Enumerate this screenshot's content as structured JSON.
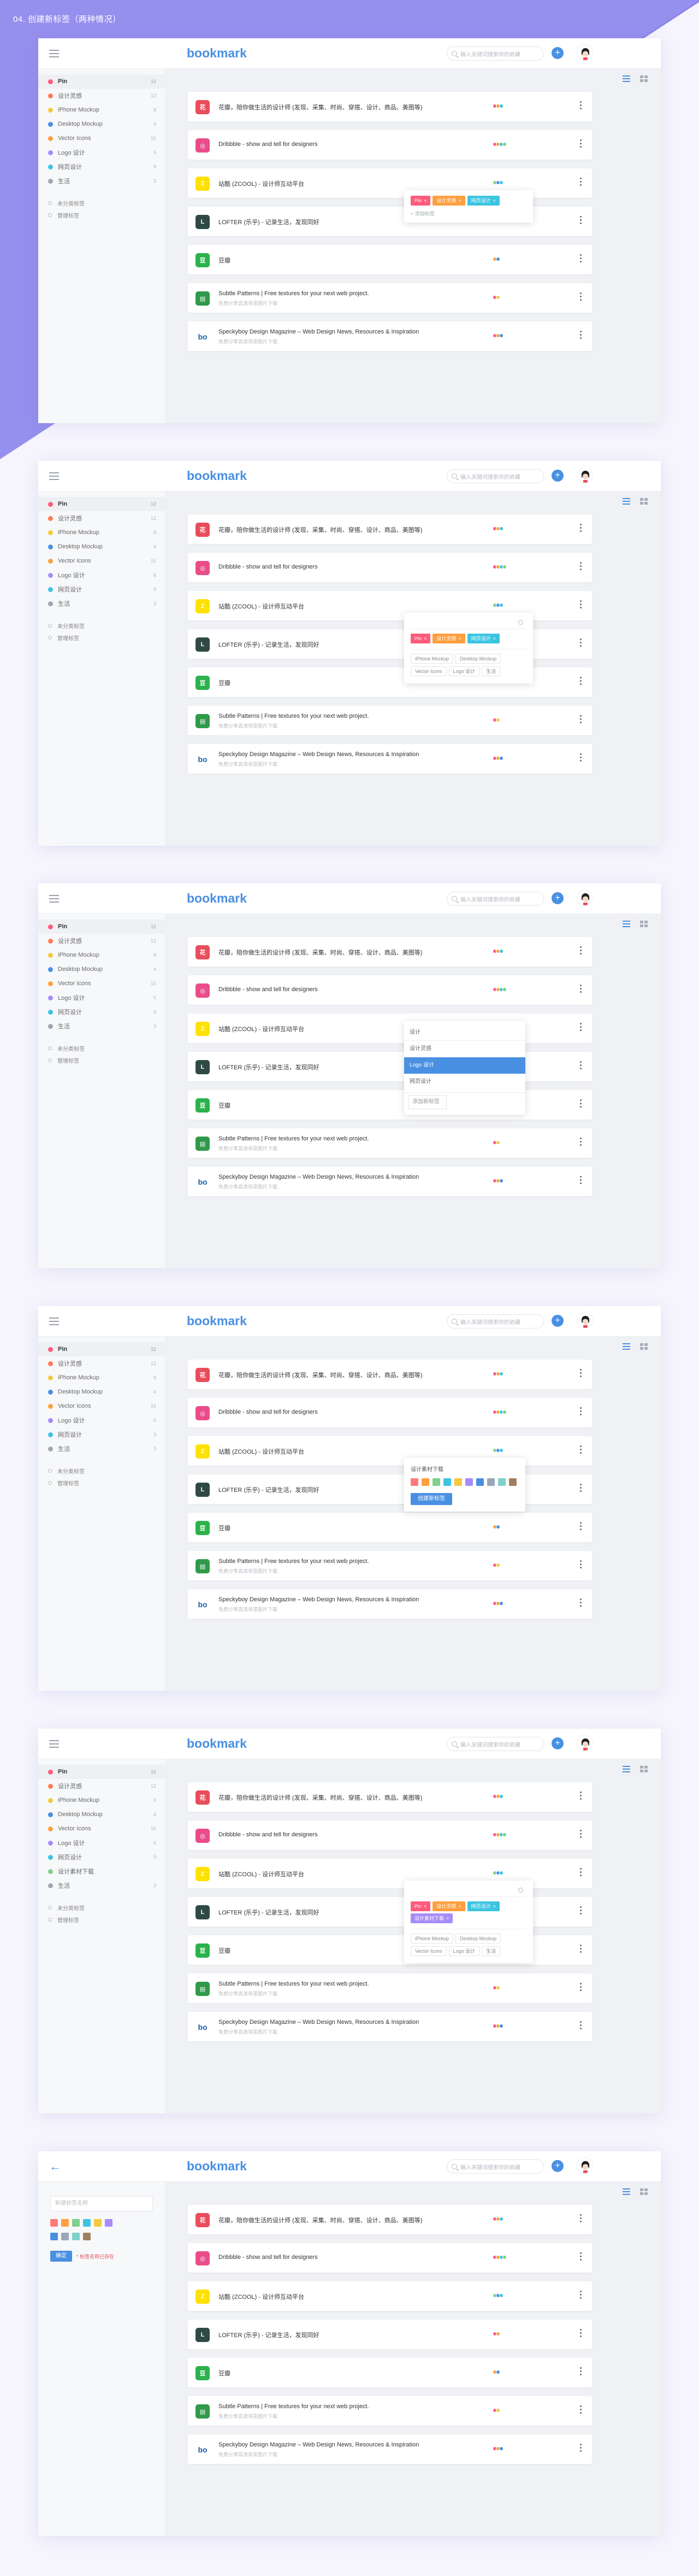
{
  "caption": "04. 创建新标签（两种情况）",
  "app": {
    "logo": "bookmark",
    "search_placeholder": "输入关键词搜索你的收藏",
    "add_label": "+"
  },
  "sidebar": {
    "items": [
      {
        "label": "Pin",
        "color": "#ff5b7b",
        "count": "12"
      },
      {
        "label": "设计灵感",
        "color": "#ff7b52",
        "count": "12"
      },
      {
        "label": "iPhone Mockup",
        "color": "#f5c93f",
        "count": "8"
      },
      {
        "label": "Desktop Mockup",
        "color": "#4a90e2",
        "count": "4"
      },
      {
        "label": "Vector Icons",
        "color": "#ff9f40",
        "count": "15"
      },
      {
        "label": "Logo 设计",
        "color": "#a78bfa",
        "count": "6"
      },
      {
        "label": "网页设计",
        "color": "#3dc4e0",
        "count": "9"
      },
      {
        "label": "生活",
        "color": "#9fa6b2",
        "count": "3"
      }
    ],
    "extra_item": {
      "label": "设计素材下载",
      "color": "#7ed08a",
      "count": "2"
    },
    "footer": [
      "未分类标签",
      "管理标签"
    ]
  },
  "bookmarks": [
    {
      "title": "花瓣，陪你做生活的设计师 (发现、采集、时尚、穿搭、设计、商品、美图等)",
      "desc": "",
      "icon_bg": "#e84d5b",
      "icon_glyph": "花",
      "tags": [
        "#ff5b7b",
        "#ff9f40",
        "#3dc4e0"
      ]
    },
    {
      "title": "Dribbble - show and tell for designers",
      "desc": "",
      "icon_bg": "#ea4c89",
      "icon_glyph": "◎",
      "tags": [
        "#ff5b7b",
        "#ff9f40",
        "#3dc4e0",
        "#7ed08a"
      ]
    },
    {
      "title": "站酷 (ZCOOL) - 设计师互动平台",
      "desc": "",
      "icon_bg": "#ffe100",
      "icon_glyph": "Z",
      "tags": [
        "#7ed08a",
        "#4a90e2",
        "#3dc4e0"
      ]
    },
    {
      "title": "LOFTER (乐乎) - 记录生活，发现同好",
      "desc": "",
      "icon_bg": "#2f4a44",
      "icon_glyph": "L",
      "tags": [
        "#ff5b7b",
        "#ff9f40"
      ]
    },
    {
      "title": "豆瓣",
      "desc": "",
      "icon_bg": "#2bb24c",
      "icon_glyph": "豆",
      "tags": [
        "#ff9f40",
        "#4a90e2"
      ]
    },
    {
      "title": "Subtle Patterns | Free textures for your next web project.",
      "desc": "免费分享高清背景图片下载",
      "icon_bg": "#2f9a4a",
      "icon_glyph": "▤",
      "tags": [
        "#ff5b7b",
        "#f5c93f"
      ]
    },
    {
      "title": "Speckyboy Design Magazine – Web Design News, Resources & Inspiration",
      "desc": "免费分享高清背景图片下载",
      "icon_bg": "#ffffff",
      "icon_glyph": "bo",
      "tags": [
        "#ff5b7b",
        "#ff9f40",
        "#4a90e2"
      ]
    }
  ],
  "tag_picker": {
    "selected": [
      {
        "label": "Pin",
        "color": "#ff5b7b"
      },
      {
        "label": "设计灵感",
        "color": "#ff9f40"
      },
      {
        "label": "网页设计",
        "color": "#3dc4e0"
      }
    ],
    "new_tag": {
      "label": "设计素材下载",
      "color": "#a78bfa"
    },
    "add_label": "+ 添加标签",
    "suggestions": [
      "iPhone Mockup",
      "Desktop Mockup",
      "Vector Icons",
      "Logo 设计",
      "生活"
    ]
  },
  "dropdown": {
    "header": "设计",
    "options": [
      "设计灵感",
      "Logo 设计",
      "网页设计"
    ],
    "selected_index": 1,
    "footer": "添加新标签"
  },
  "new_tag_popup": {
    "title": "设计素材下载",
    "colors": [
      "#ff7b7b",
      "#ff9f40",
      "#7ed08a",
      "#3dc4e0",
      "#f5c93f",
      "#a78bfa",
      "#4a90e2",
      "#9aa7b8",
      "#7ed0c8",
      "#a08060"
    ],
    "button": "创建新标签"
  },
  "sidebar_create": {
    "placeholder": "新建标签名称",
    "colors": [
      "#ff7b7b",
      "#ff9f40",
      "#7ed08a",
      "#3dc4e0",
      "#f5c93f",
      "#a78bfa",
      "#4a90e2",
      "#9aa7b8",
      "#7ed0c8",
      "#a08060"
    ],
    "button": "确定",
    "error": "* 标签名称已存在"
  }
}
